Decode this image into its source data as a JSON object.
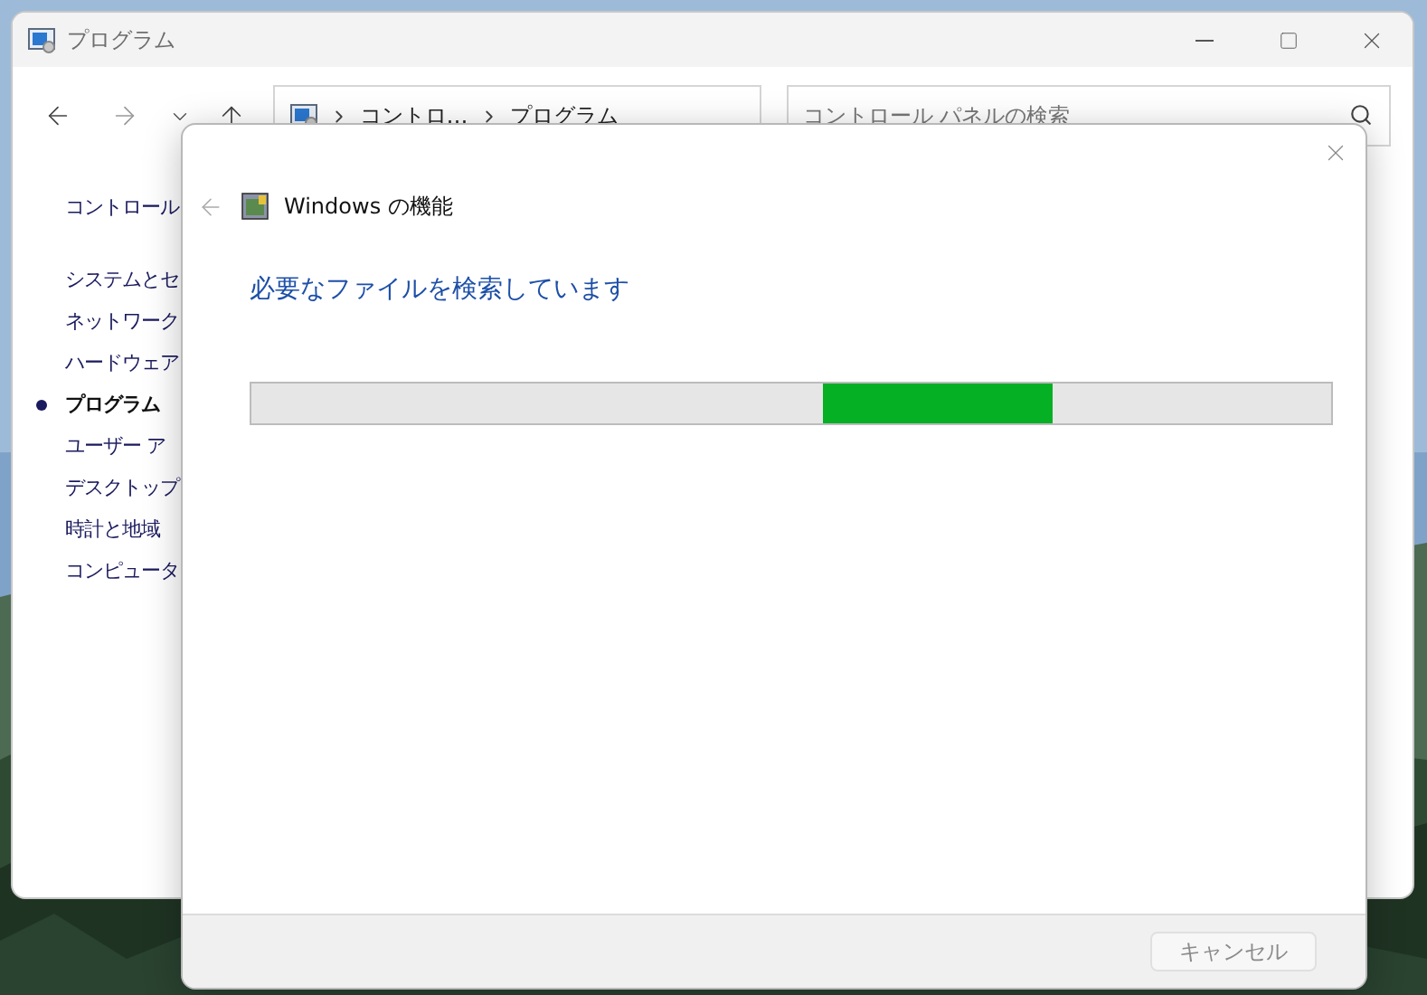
{
  "window": {
    "title": "プログラム"
  },
  "address_bar": {
    "segments": [
      "コントロ…",
      "プログラム"
    ]
  },
  "search": {
    "placeholder": "コントロール パネルの検索"
  },
  "sidebar": {
    "header": "コントロール",
    "items": [
      {
        "label": "システムとセ",
        "selected": false
      },
      {
        "label": "ネットワーク",
        "selected": false
      },
      {
        "label": "ハードウェア",
        "selected": false
      },
      {
        "label": "プログラム",
        "selected": true
      },
      {
        "label": "ユーザー ア",
        "selected": false
      },
      {
        "label": "デスクトップ",
        "selected": false
      },
      {
        "label": "時計と地域",
        "selected": false
      },
      {
        "label": "コンピュータ",
        "selected": false
      }
    ]
  },
  "dialog": {
    "title": "Windows の機能",
    "heading": "必要なファイルを検索しています",
    "progress": {
      "indeterminate": true
    },
    "buttons": [
      {
        "label": "キャンセル",
        "disabled": true
      }
    ]
  }
}
